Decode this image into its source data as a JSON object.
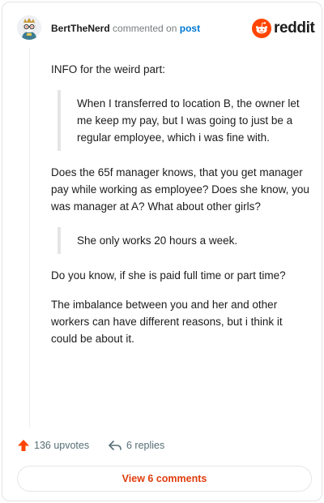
{
  "header": {
    "author": "BertTheNerd",
    "action": " commented on ",
    "target": "post"
  },
  "logo": {
    "text": "reddit"
  },
  "comment": {
    "paragraphs": [
      {
        "type": "text",
        "text": "INFO for the weird part:"
      },
      {
        "type": "quote",
        "text": "When I transferred to location B, the owner let me keep my pay, but I was going to just be a regular employee, which i was fine with."
      },
      {
        "type": "text",
        "text": "Does the 65f manager knows, that you get manager pay while working as employee? Does she know, you was manager at A? What about other girls?"
      },
      {
        "type": "quote",
        "text": "She only works 20 hours a week."
      },
      {
        "type": "text",
        "text": "Do you know, if she is paid full time or part time?"
      },
      {
        "type": "text",
        "text": "The imbalance between you and her and other workers can have different reasons, but i think it could be about it."
      }
    ]
  },
  "footer": {
    "upvotes": "136 upvotes",
    "replies": "6 replies",
    "view_comments": "View 6 comments"
  },
  "colors": {
    "brand": "#ff4500",
    "link": "#0079d3",
    "muted": "#576f76"
  },
  "icons": {
    "upvote": "upvote-arrow-icon",
    "reply": "reply-arrow-icon",
    "logo": "reddit-snoo-icon"
  }
}
